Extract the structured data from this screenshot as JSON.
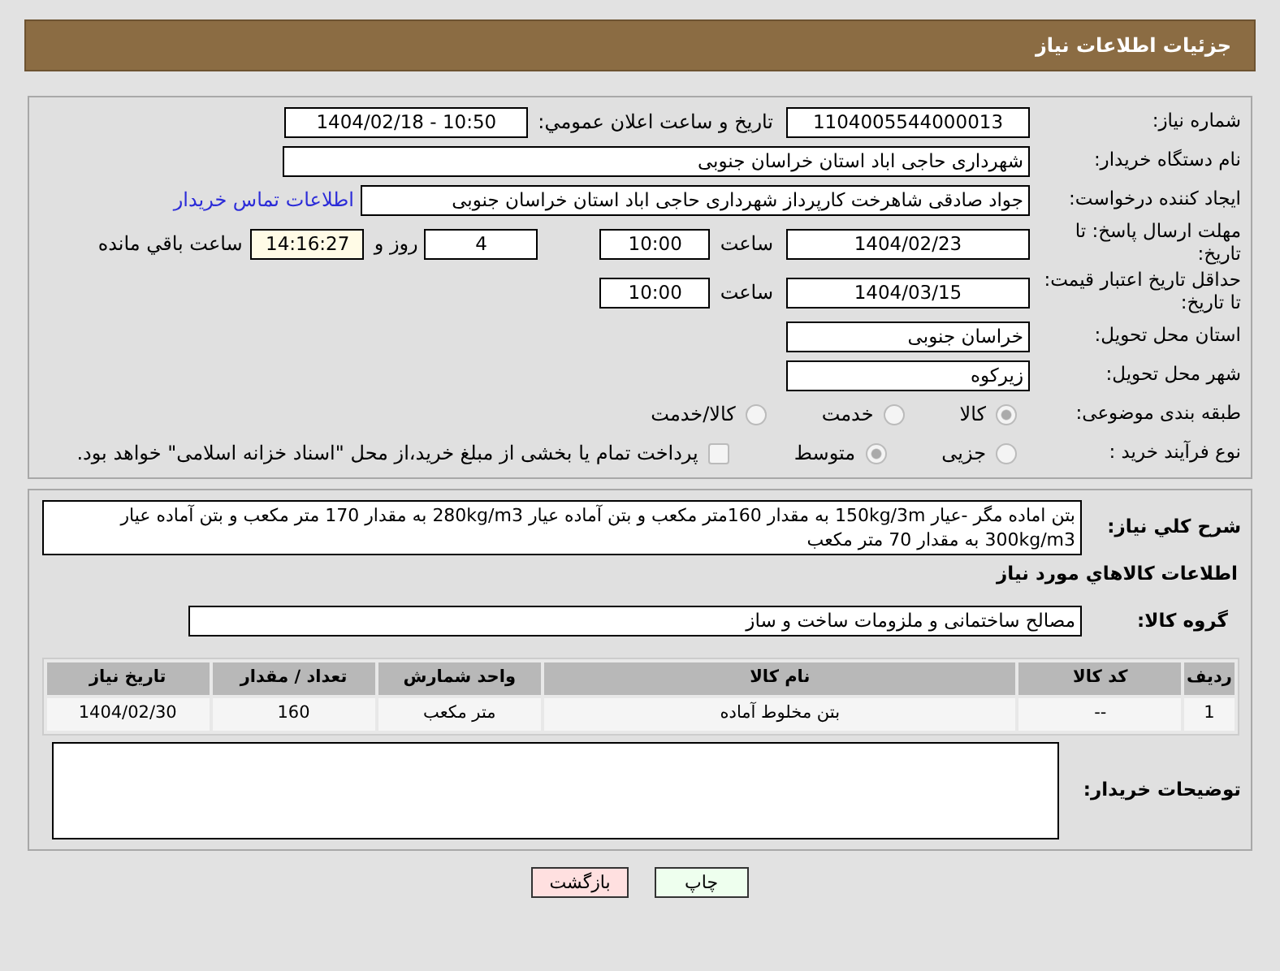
{
  "header": {
    "title": "جزئیات اطلاعات نیاز"
  },
  "need_number": {
    "label": "شماره نیاز:",
    "value": "1104005544000013"
  },
  "announce": {
    "label": "تاریخ و ساعت اعلان عمومي:",
    "value": "1404/02/18 - 10:50"
  },
  "buyer_org": {
    "label": "نام دستگاه خریدار:",
    "value": "شهرداری حاجی اباد استان خراسان جنوبی"
  },
  "requester": {
    "label": "ایجاد کننده درخواست:",
    "value": "جواد صادقی شاهرخت کارپرداز شهرداری حاجی اباد استان خراسان جنوبی",
    "link": "اطلاعات تماس خریدار"
  },
  "reply_deadline": {
    "label": "مهلت ارسال پاسخ: تا تاریخ:",
    "date": "1404/02/23",
    "time_label": "ساعت",
    "time": "10:00",
    "days": "4",
    "days_label": "روز و",
    "remaining": "14:16:27",
    "remaining_label": "ساعت باقي مانده"
  },
  "price_validity": {
    "label": "حداقل تاریخ اعتبار قیمت: تا تاریخ:",
    "date": "1404/03/15",
    "time_label": "ساعت",
    "time": "10:00"
  },
  "province": {
    "label": "استان محل تحویل:",
    "value": "خراسان جنوبی"
  },
  "city": {
    "label": "شهر محل تحویل:",
    "value": "زیرکوه"
  },
  "category": {
    "label": "طبقه بندی موضوعی:",
    "disabled": true,
    "options": [
      {
        "label": "كالا",
        "selected": true
      },
      {
        "label": "خدمت",
        "selected": false
      },
      {
        "label": "كالا/خدمت",
        "selected": false
      }
    ]
  },
  "process": {
    "label": "نوع فرآیند خرید :",
    "disabled": true,
    "options": [
      {
        "label": "جزیی",
        "selected": false
      },
      {
        "label": "متوسط",
        "selected": true
      }
    ],
    "payment": {
      "checked": false,
      "text": "پرداخت تمام یا بخشی از مبلغ خرید،از محل \"اسناد خزانه اسلامی\" خواهد بود."
    }
  },
  "description": {
    "label": "شرح كلي نياز:",
    "value": "بتن اماده مگر -عیار 150kg/3m به مقدار 160متر مکعب  و بتن آماده عیار  280kg/m3 به مقدار 170 متر مکعب و بتن آماده عیار 300kg/m3 به مقدار 70 متر مکعب"
  },
  "goods_heading": "اطلاعات كالاهاي مورد نياز",
  "goods_group": {
    "label": "گروه كالا:",
    "value": "مصالح ساختمانی و ملزومات ساخت و ساز"
  },
  "table": {
    "columns": [
      "ردیف",
      "کد کالا",
      "نام کالا",
      "واحد شمارش",
      "تعداد / مقدار",
      "تاریخ نیاز"
    ],
    "rows": [
      [
        "1",
        "--",
        "بتن مخلوط آماده",
        "متر مکعب",
        "160",
        "1404/02/30"
      ]
    ]
  },
  "notes": {
    "label": "توضیحات خریدار:"
  },
  "buttons": [
    {
      "label": "چاپ",
      "color": "#eeffee"
    },
    {
      "label": "بازگشت",
      "color": "#ffe0e0"
    }
  ]
}
